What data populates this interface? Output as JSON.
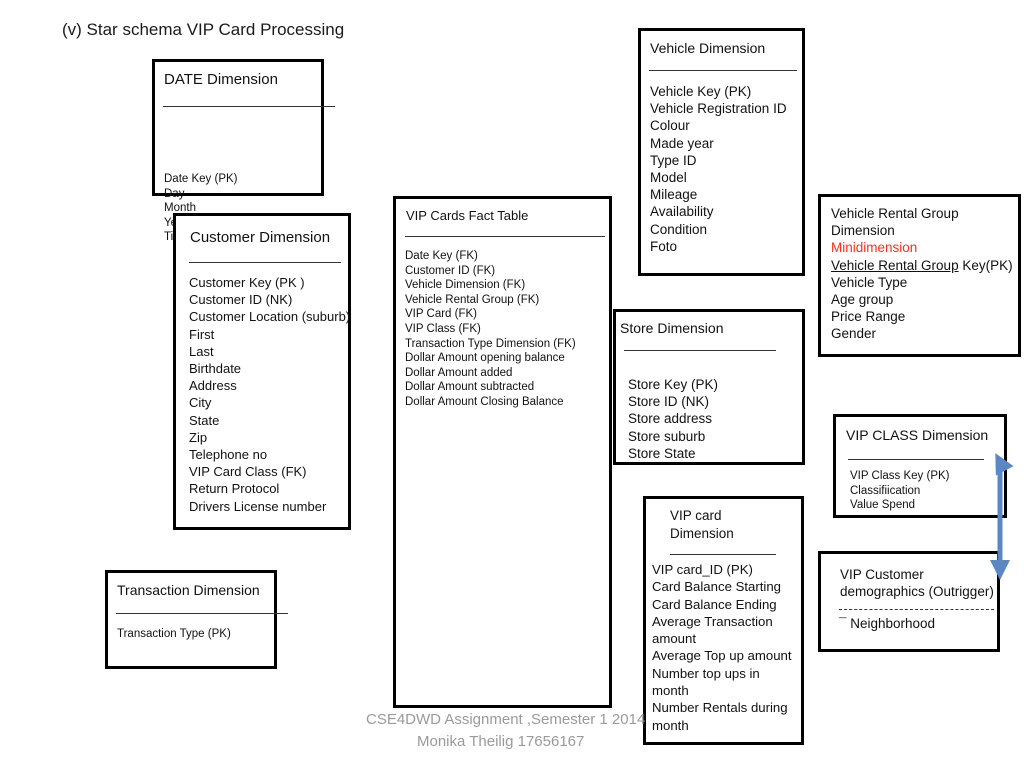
{
  "title": "(v) Star schema VIP Card Processing",
  "entities": {
    "date": {
      "header": "DATE Dimension",
      "fields": [
        "Date Key (PK)",
        "Day",
        "Month",
        "Year",
        "Time"
      ]
    },
    "customer": {
      "header": "Customer Dimension",
      "fields": [
        "Customer Key (PK )",
        "Customer ID  (NK)",
        "Customer Location (suburb)",
        "First",
        "Last",
        "Birthdate",
        "Address",
        "City",
        "State",
        "Zip",
        "Telephone no",
        "VIP Card Class (FK)",
        "Return Protocol",
        "Drivers License number"
      ]
    },
    "transaction": {
      "header": "Transaction Dimension",
      "fields": [
        "Transaction Type (PK)"
      ]
    },
    "fact": {
      "header": "VIP Cards Fact Table",
      "fields": [
        "Date Key  (FK)",
        "Customer ID (FK)",
        "Vehicle Dimension (FK)",
        "Vehicle Rental Group  (FK)",
        "VIP Card (FK)",
        "VIP Class (FK)",
        "Transaction Type Dimension (FK)",
        "Dollar Amount opening  balance",
        "Dollar Amount added",
        "Dollar Amount subtracted",
        "Dollar Amount Closing Balance"
      ]
    },
    "vehicle": {
      "header": "Vehicle Dimension",
      "fields": [
        "Vehicle Key (PK)",
        "Vehicle Registration ID",
        "Colour",
        "Made year",
        "Type ID",
        "Model",
        "Mileage",
        "Availability",
        "Condition",
        "Foto"
      ]
    },
    "vehicle_rental_group": {
      "line1": "Vehicle Rental Group",
      "line2": "Dimension",
      "minidimension_label": "Minidimension",
      "minidimension_color": "#ff2d18",
      "key_underlined": "Vehicle Rental Group",
      "key_rest": " Key(PK)",
      "fields": [
        "Vehicle Type",
        "Age group",
        "Price Range",
        "Gender"
      ]
    },
    "store": {
      "header": "Store Dimension",
      "fields": [
        "Store Key (PK)",
        "Store ID (NK)",
        "Store address",
        "Store suburb",
        "Store State"
      ]
    },
    "vip_class": {
      "header": "VIP CLASS Dimension",
      "fields": [
        "VIP Class Key (PK)",
        "Classifiication",
        "Value Spend"
      ]
    },
    "vip_customer_demographics": {
      "header": "VIP Customer\ndemographics (Outrigger)",
      "fields": [
        "¯ Neighborhood"
      ]
    },
    "vip_card": {
      "header": "VIP card\nDimension",
      "fields": [
        "VIP card_ID (PK)",
        "Card Balance Starting",
        "Card Balance Ending",
        "Average Transaction",
        "amount",
        "Average Top up amount",
        "Number top ups in",
        "month",
        "Number Rentals during",
        "month"
      ]
    }
  },
  "connector": {
    "name": "vip-class-to-demographics-arrow",
    "color": "#5b88c5",
    "double_headed": true
  },
  "footer": {
    "line1": "CSE4DWD    Assignment ,Semester 1 2014",
    "line2": "Monika Theilig    17656167",
    "color": "#9a9a9a"
  }
}
